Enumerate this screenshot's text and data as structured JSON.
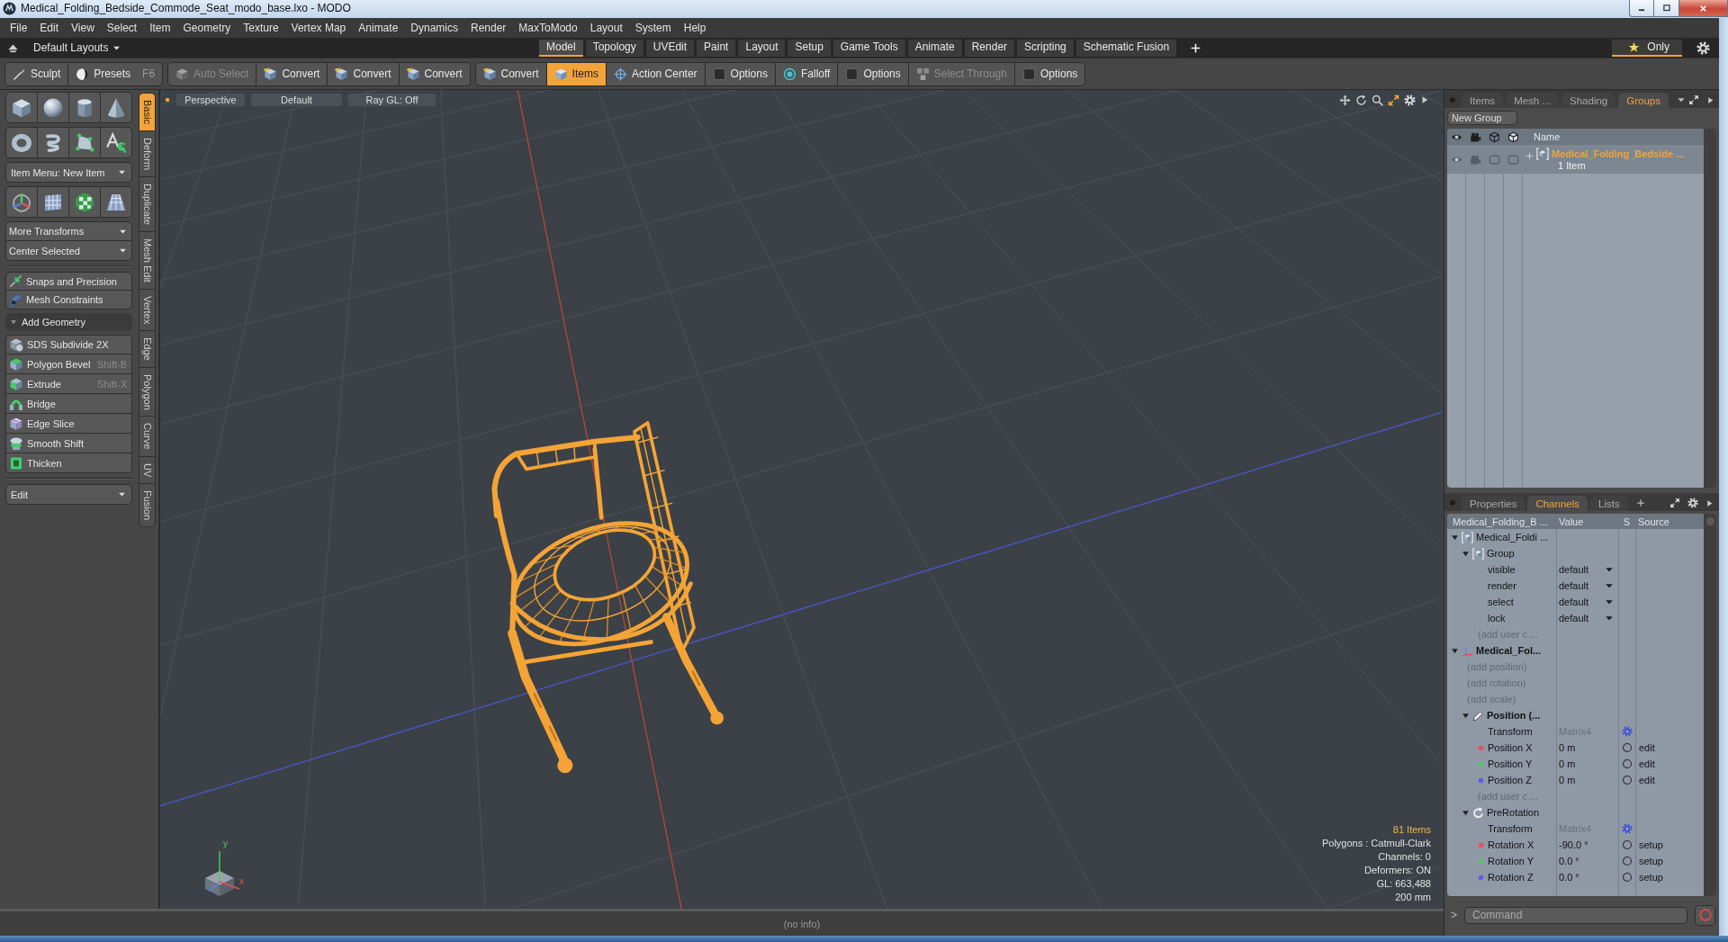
{
  "window": {
    "title": "Medical_Folding_Bedside_Commode_Seat_modo_base.lxo - MODO"
  },
  "menu": [
    "File",
    "Edit",
    "View",
    "Select",
    "Item",
    "Geometry",
    "Texture",
    "Vertex Map",
    "Animate",
    "Dynamics",
    "Render",
    "MaxToModo",
    "Layout",
    "System",
    "Help"
  ],
  "layout_bar": {
    "layouts": "Default Layouts",
    "tabs": [
      {
        "label": "Model",
        "selected": true
      },
      {
        "label": "Topology",
        "selected": false
      },
      {
        "label": "UVEdit",
        "selected": false
      },
      {
        "label": "Paint",
        "selected": false
      },
      {
        "label": "Layout",
        "selected": false
      },
      {
        "label": "Setup",
        "selected": false
      },
      {
        "label": "Game Tools",
        "selected": false
      },
      {
        "label": "Animate",
        "selected": false
      },
      {
        "label": "Render",
        "selected": false
      },
      {
        "label": "Scripting",
        "selected": false
      },
      {
        "label": "Schematic Fusion",
        "selected": false
      }
    ],
    "filter": {
      "label": "Only",
      "on": true
    }
  },
  "toolbar": {
    "groups": [
      {
        "buttons": [
          {
            "label": "Sculpt",
            "selected": false,
            "disabled": false
          },
          {
            "label": "Presets",
            "shortcut": "F6",
            "selected": false,
            "disabled": false
          }
        ]
      },
      {
        "buttons": [
          {
            "label": "Auto Select",
            "selected": false,
            "disabled": true
          },
          {
            "label": "Convert",
            "selected": false,
            "disabled": false
          },
          {
            "label": "Convert",
            "selected": false,
            "disabled": false
          },
          {
            "label": "Convert",
            "selected": false,
            "disabled": false
          }
        ]
      },
      {
        "buttons": [
          {
            "label": "Convert",
            "selected": false,
            "disabled": false
          },
          {
            "label": "Items",
            "selected": true,
            "disabled": false
          },
          {
            "label": "Action Center",
            "selected": false,
            "disabled": false
          },
          {
            "label": "Options",
            "selected": false,
            "disabled": false
          },
          {
            "label": "Falloff",
            "selected": false,
            "disabled": false
          },
          {
            "label": "Options",
            "selected": false,
            "disabled": false
          },
          {
            "label": "Select Through",
            "selected": false,
            "disabled": true
          },
          {
            "label": "Options",
            "selected": false,
            "disabled": false
          }
        ]
      }
    ]
  },
  "left_panel": {
    "item_menu": "Item Menu: New Item",
    "transforms": [
      "More Transforms",
      "Center Selected"
    ],
    "constraints": [
      "Snaps and Precision",
      "Mesh Constraints"
    ],
    "add_geometry": {
      "label": "Add Geometry",
      "expanded": true,
      "tools": [
        {
          "label": "SDS Subdivide 2X"
        },
        {
          "label": "Polygon Bevel",
          "shortcut": "Shift-B"
        },
        {
          "label": "Extrude",
          "shortcut": "Shift-X"
        },
        {
          "label": "Bridge"
        },
        {
          "label": "Edge Slice"
        },
        {
          "label": "Smooth Shift"
        },
        {
          "label": "Thicken"
        }
      ]
    },
    "edit_menu": "Edit",
    "tabs": [
      {
        "label": "Basic",
        "selected": true
      },
      {
        "label": "Deform",
        "selected": false
      },
      {
        "label": "Duplicate",
        "selected": false
      },
      {
        "label": "Mesh Edit",
        "selected": false
      },
      {
        "label": "Vertex",
        "selected": false
      },
      {
        "label": "Edge",
        "selected": false
      },
      {
        "label": "Polygon",
        "selected": false
      },
      {
        "label": "Curve",
        "selected": false
      },
      {
        "label": "UV",
        "selected": false
      },
      {
        "label": "Fusion",
        "selected": false
      }
    ]
  },
  "viewport": {
    "view": "Perspective",
    "shading": "Default",
    "ray_gl": "Ray GL: Off",
    "axis_labels": [
      "y",
      "x"
    ],
    "info": [
      {
        "text": "81 Items",
        "highlighted": true
      },
      {
        "text": "Polygons : Catmull-Clark",
        "highlighted": false
      },
      {
        "text": "Channels: 0",
        "highlighted": false
      },
      {
        "text": "Deformers: ON",
        "highlighted": false
      },
      {
        "text": "GL: 663,488",
        "highlighted": false
      },
      {
        "text": "200 mm",
        "highlighted": false
      }
    ]
  },
  "status_bar": {
    "text": "(no info)"
  },
  "groups_panel": {
    "tabs": [
      {
        "label": "Items",
        "selected": false
      },
      {
        "label": "Mesh ...",
        "selected": false
      },
      {
        "label": "Shading",
        "selected": false
      },
      {
        "label": "Groups",
        "selected": true
      }
    ],
    "new_group": "New Group",
    "name_column": "Name",
    "rows": [
      {
        "name": "Medical_Folding_Bedside ...",
        "count": "1 Item",
        "selected": true,
        "expanded": false
      }
    ]
  },
  "channels_panel": {
    "tabs": [
      {
        "label": "Properties",
        "selected": false
      },
      {
        "label": "Channels",
        "selected": true
      },
      {
        "label": "Lists",
        "selected": false
      }
    ],
    "columns": [
      "Medical_Folding_B ...",
      "Value",
      "S",
      "Source"
    ],
    "tree": [
      {
        "label": "Medical_Foldi ...",
        "kind": "mesh",
        "expanded": true,
        "bold": false,
        "children": [
          {
            "label": "Group",
            "kind": "group",
            "expanded": true,
            "bold": false,
            "children": [
              {
                "label": "visible",
                "kind": "enum",
                "value": "default"
              },
              {
                "label": "render",
                "kind": "enum",
                "value": "default"
              },
              {
                "label": "select",
                "kind": "enum",
                "value": "default"
              },
              {
                "label": "lock",
                "kind": "enum",
                "value": "default"
              },
              {
                "label": "(add user c ...",
                "kind": "add"
              }
            ]
          }
        ]
      },
      {
        "label": "Medical_Fol...",
        "kind": "locator",
        "expanded": true,
        "bold": true,
        "children": [
          {
            "label": "(add position)",
            "kind": "add"
          },
          {
            "label": "(add rotation)",
            "kind": "add"
          },
          {
            "label": "(add scale)",
            "kind": "add"
          },
          {
            "label": "Position (...",
            "kind": "transform",
            "expanded": true,
            "bold": true,
            "children": [
              {
                "label": "Transform",
                "kind": "matrix",
                "value": "Matrix4"
              },
              {
                "label": "Position X",
                "kind": "channel",
                "color": "#e8505e",
                "value": "0 m",
                "source": "edit"
              },
              {
                "label": "Position Y",
                "kind": "channel",
                "color": "#5cc46a",
                "value": "0 m",
                "source": "edit"
              },
              {
                "label": "Position Z",
                "kind": "channel",
                "color": "#5a60e6",
                "value": "0 m",
                "source": "edit"
              },
              {
                "label": "(add user c ...",
                "kind": "add"
              }
            ]
          },
          {
            "label": "PreRotation",
            "kind": "rotation",
            "expanded": true,
            "bold": false,
            "children": [
              {
                "label": "Transform",
                "kind": "matrix",
                "value": "Matrix4"
              },
              {
                "label": "Rotation X",
                "kind": "channel",
                "color": "#e8505e",
                "value": "-90.0 °",
                "source": "setup"
              },
              {
                "label": "Rotation Y",
                "kind": "channel",
                "color": "#5cc46a",
                "value": "0.0 °",
                "source": "setup"
              },
              {
                "label": "Rotation Z",
                "kind": "channel",
                "color": "#5a60e6",
                "value": "0.0 °",
                "source": "setup"
              }
            ]
          }
        ]
      }
    ],
    "command": {
      "prompt": ">",
      "placeholder": "Command"
    }
  }
}
